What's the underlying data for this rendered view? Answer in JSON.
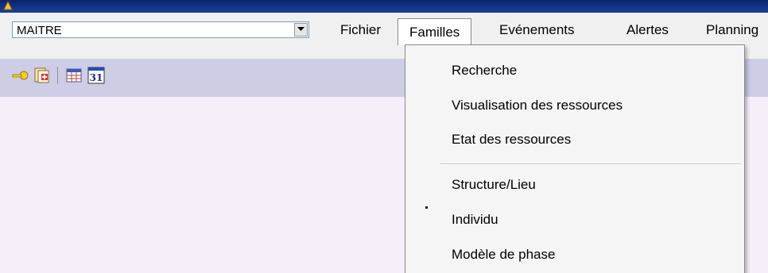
{
  "combo": {
    "value": "MAITRE"
  },
  "menu": {
    "items": [
      {
        "label": "Fichier"
      },
      {
        "label": "Familles"
      },
      {
        "label": "Evénements"
      },
      {
        "label": "Alertes"
      },
      {
        "label": "Planning"
      }
    ],
    "open_index": 1
  },
  "toolbar": {
    "icons": [
      "key-icon",
      "document-add-icon",
      "grid-calendar-icon",
      "calendar-31-icon"
    ],
    "calendar_day": "31"
  },
  "dropdown": {
    "items": [
      {
        "label": "Recherche"
      },
      {
        "label": "Visualisation des ressources"
      },
      {
        "label": "Etat des ressources"
      },
      {
        "label": "Structure/Lieu"
      },
      {
        "label": "Individu"
      },
      {
        "label": "Modèle de phase"
      }
    ]
  },
  "colors": {
    "title_bar": "#0a246a",
    "menu_bar": "#f0f0f0",
    "toolbar": "#cdcde6",
    "content": "#f6eef8",
    "dropdown": "#f5f5f5"
  }
}
